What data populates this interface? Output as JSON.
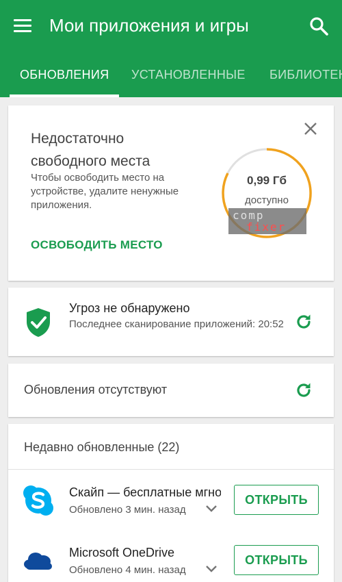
{
  "appbar": {
    "title": "Мои приложения и игры",
    "color": "#1a9c4f",
    "menu_icon": "hamburger-menu-icon",
    "search_icon": "search-icon"
  },
  "tabs": [
    {
      "label": "ОБНОВЛЕНИЯ",
      "active": true
    },
    {
      "label": "УСТАНОВЛЕННЫЕ",
      "active": false
    },
    {
      "label": "БИБЛИОТЕКА",
      "active": false
    }
  ],
  "storage": {
    "title": "Недостаточно свободного места",
    "description": "Чтобы освободить место на устройстве, удалите ненужные приложения.",
    "action": "ОСВОБОДИТЬ МЕСТО",
    "value": "0,99 Гб",
    "value_label": "доступно",
    "ring_color": "#f0a21e",
    "close_icon": "close-icon"
  },
  "watermark": {
    "line1": "comp",
    "line2": "fixer"
  },
  "security": {
    "title": "Угроз не обнаружено",
    "description": "Последнее сканирование приложений: 20:52",
    "icon": "shield-check-icon"
  },
  "updates": {
    "text": "Обновления отсутствуют"
  },
  "recent": {
    "title": "Недавно обновленные (22)",
    "apps": [
      {
        "name": "Скайп — бесплатные мгновенные сообщения",
        "status": "Обновлено 3 мин. назад",
        "action": "ОТКРЫТЬ",
        "icon": "skype-icon"
      },
      {
        "name": "Microsoft OneDrive",
        "status": "Обновлено 4 мин. назад",
        "action": "ОТКРЫТЬ",
        "icon": "onedrive-icon"
      }
    ]
  }
}
